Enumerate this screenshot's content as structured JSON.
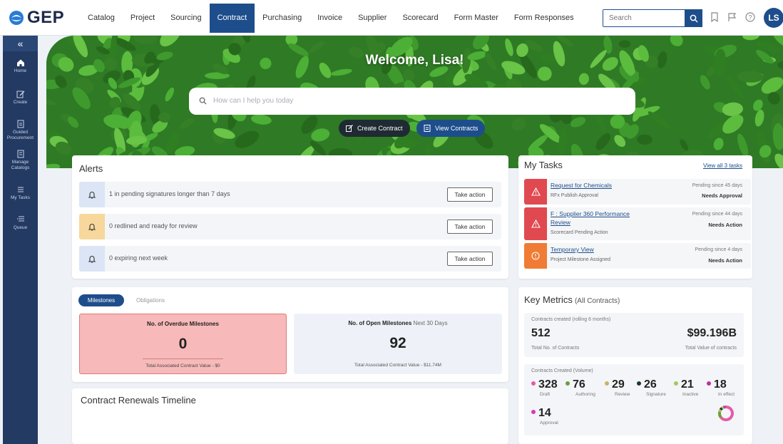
{
  "brand": {
    "name": "GEP",
    "accent": "#1e4d8c"
  },
  "nav": {
    "items": [
      "Catalog",
      "Project",
      "Sourcing",
      "Contract",
      "Purchasing",
      "Invoice",
      "Supplier",
      "Scorecard",
      "Form Master",
      "Form Responses"
    ],
    "active": "Contract"
  },
  "search": {
    "placeholder": "Search"
  },
  "user": {
    "initials": "LS"
  },
  "sidebar": {
    "collapse_glyph": "«",
    "items": [
      {
        "label": "Home",
        "icon": "home-icon"
      },
      {
        "label": "Create",
        "icon": "edit-icon"
      },
      {
        "label": "Guided Procurement",
        "icon": "document-icon"
      },
      {
        "label": "Manage Catalogs",
        "icon": "catalog-icon"
      },
      {
        "label": "My Tasks",
        "icon": "list-icon"
      },
      {
        "label": "Queue",
        "icon": "queue-icon"
      }
    ]
  },
  "hero": {
    "welcome": "Welcome, Lisa!",
    "search_placeholder": "How can I help you today",
    "create_button": "Create Contract",
    "view_button": "View Contracts"
  },
  "alerts": {
    "title": "Alerts",
    "action_label": "Take action",
    "items": [
      {
        "text": "1 in pending signatures longer than 7 days",
        "color": "#dbe5f5"
      },
      {
        "text": "0 redlined and ready for review",
        "color": "#f7d79b"
      },
      {
        "text": "0 expiring next week",
        "color": "#dbe5f5"
      }
    ]
  },
  "tasks": {
    "title": "My Tasks",
    "view_all": "View all 3 tasks",
    "items": [
      {
        "name": "Request for Chemicals",
        "sub": "RFx Publish Approval",
        "pending": "Pending since 45 days",
        "status": "Needs Approval",
        "color": "#e0494f",
        "icon": "warning-icon"
      },
      {
        "name": "F : Supplier 360 Performance",
        "name2": "Review",
        "sub": "Scorecard Pending Action",
        "pending": "Pending since 44 days",
        "status": "Needs Action",
        "color": "#e0494f",
        "icon": "warning-icon"
      },
      {
        "name": "Temporary View",
        "sub": "Project Milestone Assigned",
        "pending": "Pending since 4 days",
        "status": "Needs Action",
        "color": "#f07b35",
        "icon": "alert-circle-icon"
      }
    ]
  },
  "milestones": {
    "tabs": [
      "Milestones",
      "Obligations"
    ],
    "overdue": {
      "title": "No. of Overdue Milestones",
      "value": "0",
      "footer": "Total Associated Contract Value - $0"
    },
    "open": {
      "title": "No. of Open Milestones",
      "suffix": "Next 30 Days",
      "value": "92",
      "footer": "Total Associated Contract Value - $11.74M"
    }
  },
  "renewals": {
    "title": "Contract Renewals Timeline"
  },
  "metrics": {
    "title": "Key Metrics",
    "subtitle": "(All Contracts)",
    "created_label": "Contracts created (rolling 6 months)",
    "total_contracts": "512",
    "total_contracts_label": "Total No. of Contracts",
    "total_value": "$99.196B",
    "total_value_label": "Total Value of contracts",
    "volume_label": "Contracts Created (Volume)",
    "volume": [
      {
        "value": "328",
        "label": "Draft",
        "color": "#e85aa8"
      },
      {
        "value": "76",
        "label": "Authoring",
        "color": "#6b9e3c"
      },
      {
        "value": "29",
        "label": "Review",
        "color": "#c8b16a"
      },
      {
        "value": "26",
        "label": "Signature",
        "color": "#1c3a2a"
      },
      {
        "value": "21",
        "label": "Inactive",
        "color": "#a5c85a"
      },
      {
        "value": "18",
        "label": "In effect",
        "color": "#c2309a"
      },
      {
        "value": "14",
        "label": "Approval",
        "color": "#d63ab8"
      }
    ]
  }
}
